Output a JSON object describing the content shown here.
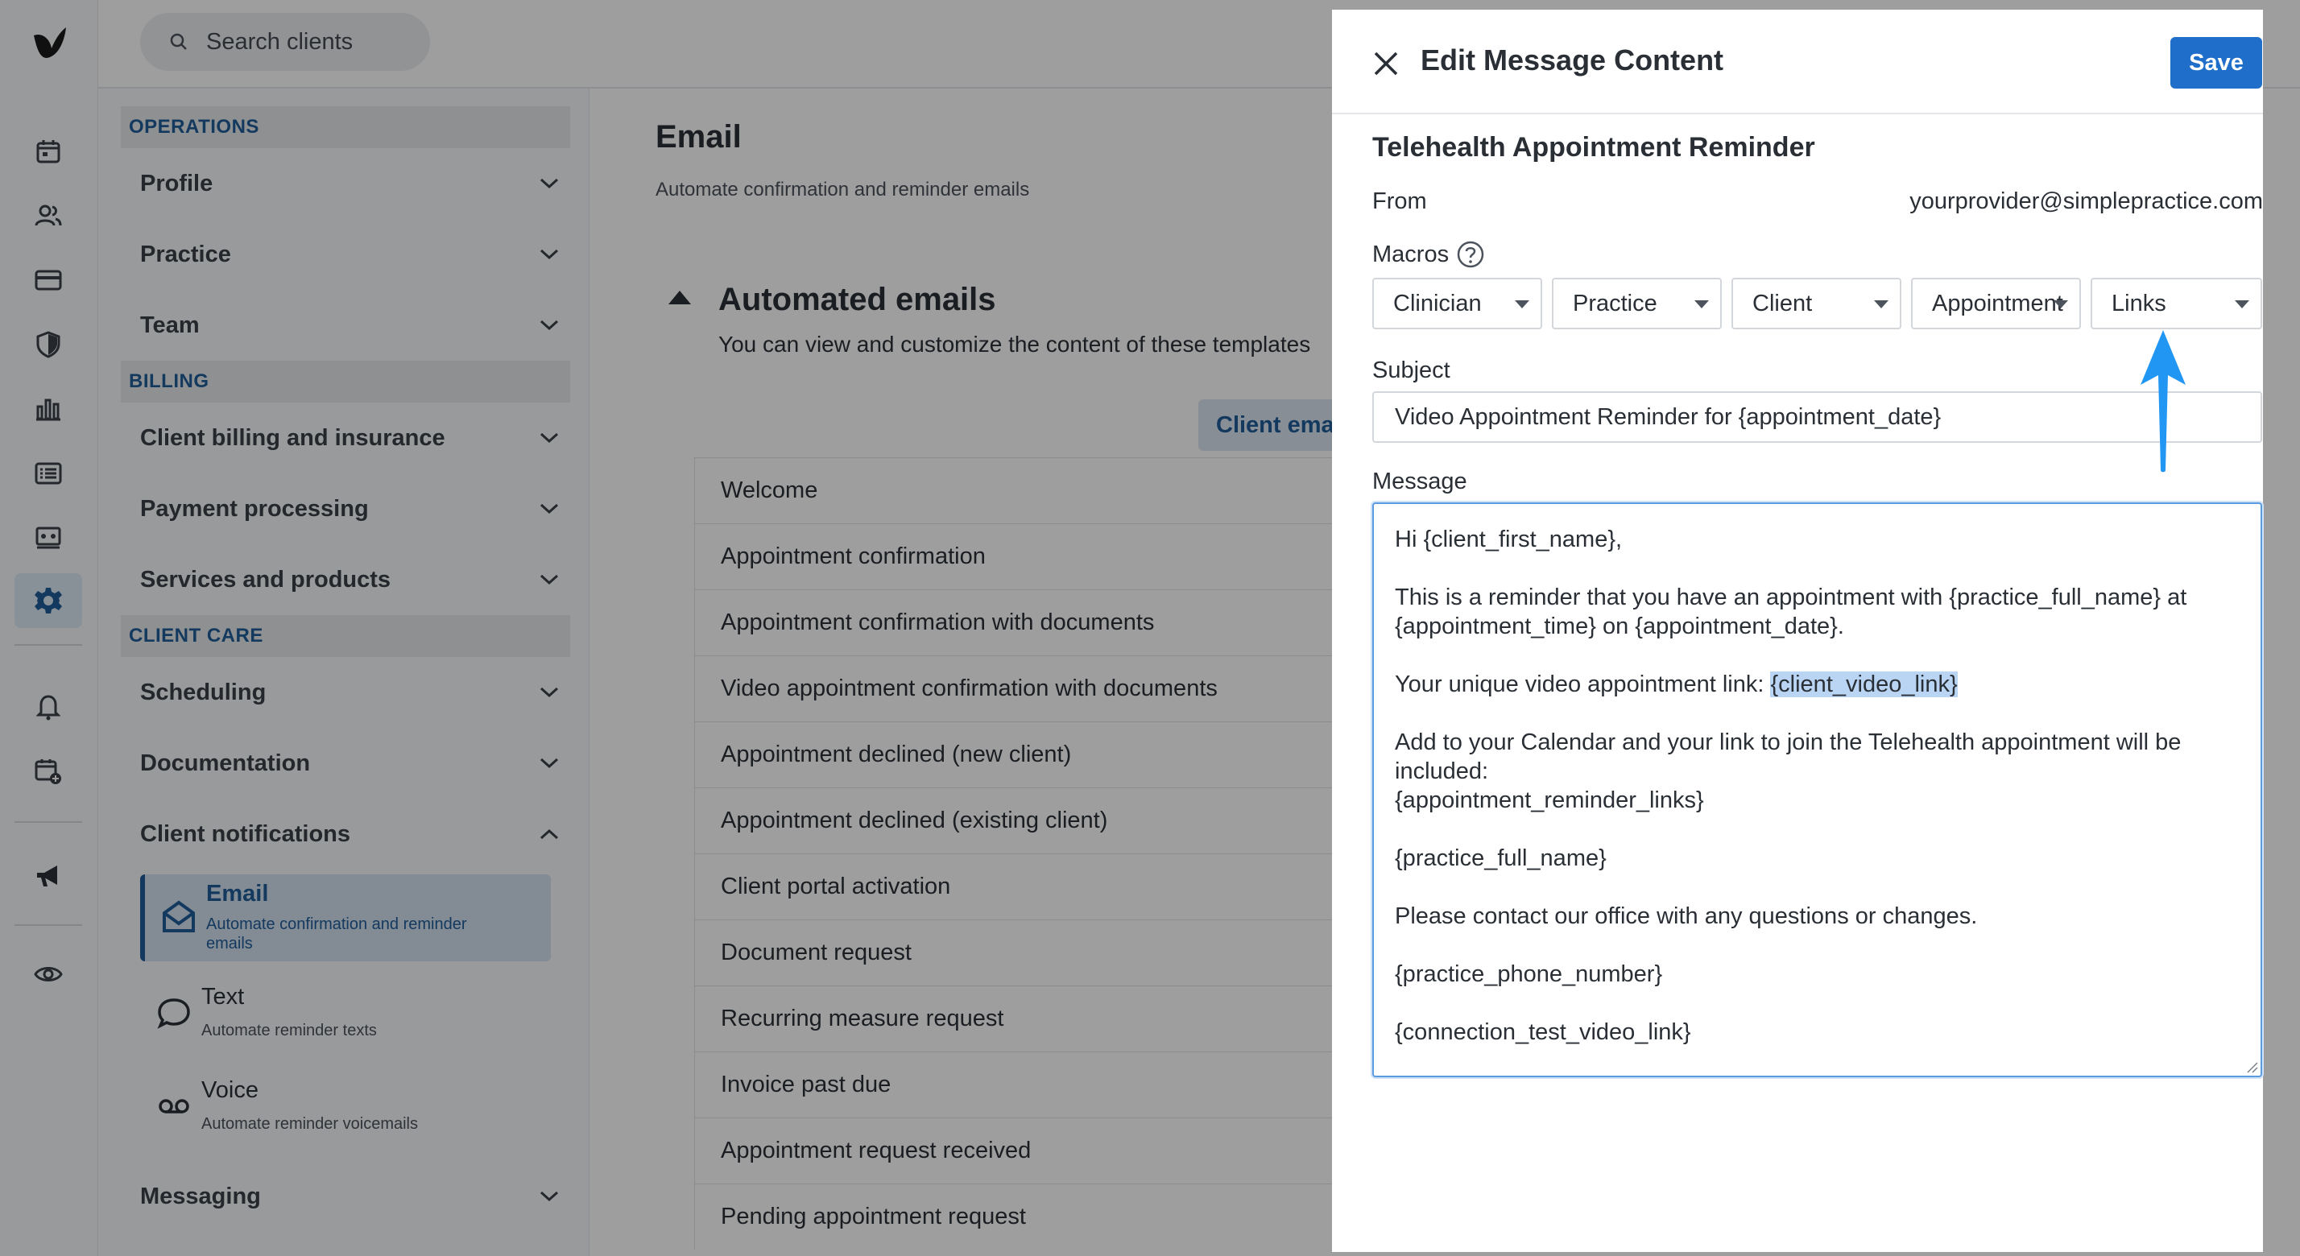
{
  "search": {
    "placeholder": "Search clients"
  },
  "nav": {
    "sections": {
      "operations": "OPERATIONS",
      "billing": "BILLING",
      "client_care": "CLIENT CARE"
    },
    "items": {
      "profile": "Profile",
      "practice": "Practice",
      "team": "Team",
      "client_billing": "Client billing and insurance",
      "payment_processing": "Payment processing",
      "services_products": "Services and products",
      "scheduling": "Scheduling",
      "documentation": "Documentation",
      "client_notifications": "Client notifications",
      "messaging": "Messaging"
    },
    "subitems": [
      {
        "title": "Email",
        "desc": "Automate confirmation and reminder emails"
      },
      {
        "title": "Text",
        "desc": "Automate reminder texts"
      },
      {
        "title": "Voice",
        "desc": "Automate reminder voicemails"
      }
    ]
  },
  "main": {
    "title": "Email",
    "desc": "Automate confirmation and reminder emails",
    "automated_heading": "Automated emails",
    "automated_sub": "You can view and customize the content of these templates",
    "client_tab": "Client emails",
    "templates": [
      "Welcome",
      "Appointment confirmation",
      "Appointment confirmation with documents",
      "Video appointment confirmation with documents",
      "Appointment declined (new client)",
      "Appointment declined (existing client)",
      "Client portal activation",
      "Document request",
      "Recurring measure request",
      "Invoice past due",
      "Appointment request received",
      "Pending appointment request"
    ]
  },
  "drawer": {
    "title": "Edit Message Content",
    "save_label": "Save",
    "template_name": "Telehealth Appointment Reminder",
    "from_label": "From",
    "from_value": "yourprovider@simplepractice.com",
    "macros_label": "Macros",
    "macros": [
      "Clinician",
      "Practice",
      "Client",
      "Appointment",
      "Links"
    ],
    "subject_label": "Subject",
    "subject_value": "Video Appointment Reminder for {appointment_date}",
    "message_label": "Message",
    "message": {
      "greeting": "Hi {client_first_name},",
      "line1": "This is a reminder that you have an appointment with {practice_full_name} at",
      "line2": "{appointment_time} on {appointment_date}.",
      "link_prefix": "Your unique video appointment link: ",
      "link_macro": "{client_video_link}",
      "calendar1": "Add to your Calendar and your link to join the Telehealth appointment will be",
      "calendar2": "included:",
      "calendar3": "{appointment_reminder_links}",
      "practice": "{practice_full_name}",
      "contact": "Please contact our office with any questions or changes.",
      "phone": "{practice_phone_number}",
      "test_link": "{connection_test_video_link}"
    }
  },
  "colors": {
    "accent": "#1f6ec9",
    "nav_accent": "#1f5d9a",
    "annotation_arrow": "#2196f3",
    "highlight": "#b9d5f3"
  },
  "icons": [
    "logo-icon",
    "calendar-icon",
    "clients-icon",
    "billing-card-icon",
    "shield-icon",
    "reports-icon",
    "list-icon",
    "marketplace-icon",
    "settings-gear-icon",
    "bell-icon",
    "calendar-add-icon",
    "megaphone-icon",
    "eye-icon",
    "search-icon",
    "chevron-down-icon",
    "chevron-up-icon",
    "envelope-open-icon",
    "chat-bubble-icon",
    "voicemail-icon",
    "close-icon",
    "help-icon",
    "caret-down-icon",
    "arrow-up-icon"
  ]
}
